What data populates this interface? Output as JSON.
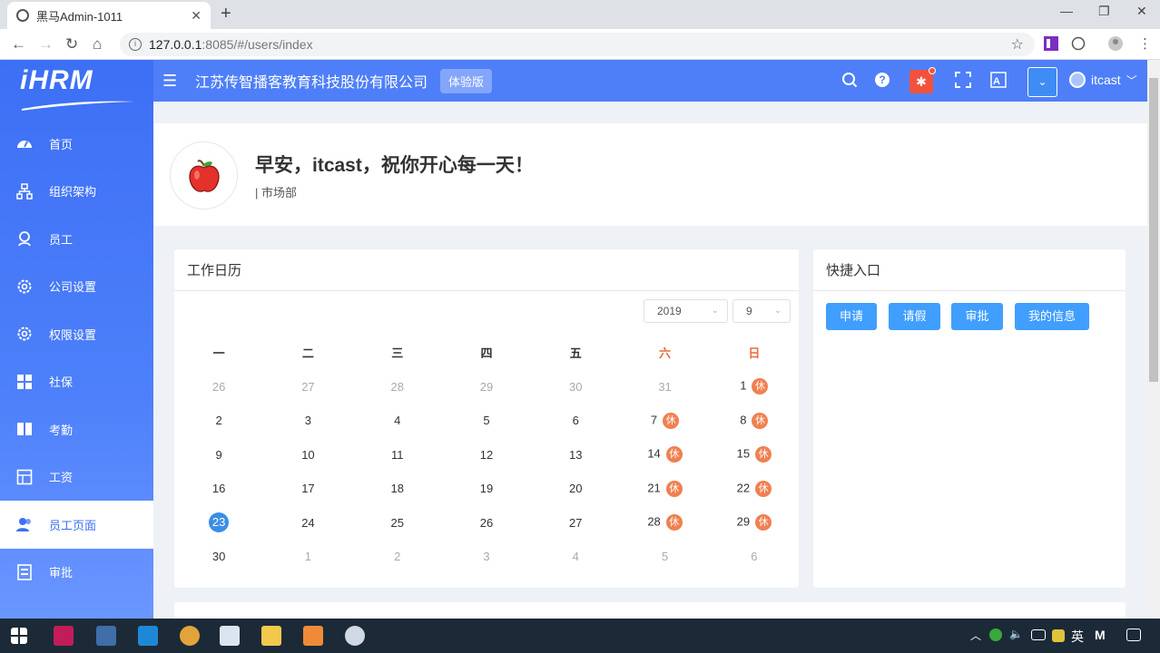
{
  "browser": {
    "tab_title": "黑马Admin-1011",
    "url_host": "127.0.0.1",
    "url_rest": ":8085/#/users/index"
  },
  "sidebar": {
    "logo": "iHRM",
    "items": [
      {
        "label": "首页",
        "icon": "dashboard-icon"
      },
      {
        "label": "组织架构",
        "icon": "org-tree-icon"
      },
      {
        "label": "员工",
        "icon": "people-icon"
      },
      {
        "label": "公司设置",
        "icon": "gear-icon"
      },
      {
        "label": "权限设置",
        "icon": "gear-icon"
      },
      {
        "label": "社保",
        "icon": "grid-icon"
      },
      {
        "label": "考勤",
        "icon": "book-icon"
      },
      {
        "label": "工资",
        "icon": "table-icon"
      },
      {
        "label": "员工页面",
        "icon": "user-icon"
      },
      {
        "label": "审批",
        "icon": "approval-icon"
      }
    ],
    "active_index": 8
  },
  "header": {
    "company": "江苏传智播客教育科技股份有限公司",
    "badge": "体验版",
    "username": "itcast"
  },
  "welcome": {
    "greeting": "早安，itcast，祝你开心每一天！",
    "department": "| 市场部"
  },
  "calendar": {
    "title": "工作日历",
    "year": "2019",
    "month": "9",
    "weekdays": [
      "一",
      "二",
      "三",
      "四",
      "五",
      "六",
      "日"
    ],
    "rest_label": "休",
    "weeks": [
      [
        {
          "d": "26",
          "dim": true
        },
        {
          "d": "27",
          "dim": true
        },
        {
          "d": "28",
          "dim": true
        },
        {
          "d": "29",
          "dim": true
        },
        {
          "d": "30",
          "dim": true
        },
        {
          "d": "31",
          "dim": true
        },
        {
          "d": "1",
          "rest": true
        }
      ],
      [
        {
          "d": "2"
        },
        {
          "d": "3"
        },
        {
          "d": "4"
        },
        {
          "d": "5"
        },
        {
          "d": "6"
        },
        {
          "d": "7",
          "rest": true
        },
        {
          "d": "8",
          "rest": true
        }
      ],
      [
        {
          "d": "9"
        },
        {
          "d": "10"
        },
        {
          "d": "11"
        },
        {
          "d": "12"
        },
        {
          "d": "13"
        },
        {
          "d": "14",
          "rest": true
        },
        {
          "d": "15",
          "rest": true
        }
      ],
      [
        {
          "d": "16"
        },
        {
          "d": "17"
        },
        {
          "d": "18"
        },
        {
          "d": "19"
        },
        {
          "d": "20"
        },
        {
          "d": "21",
          "rest": true
        },
        {
          "d": "22",
          "rest": true
        }
      ],
      [
        {
          "d": "23",
          "today": true
        },
        {
          "d": "24"
        },
        {
          "d": "25"
        },
        {
          "d": "26"
        },
        {
          "d": "27"
        },
        {
          "d": "28",
          "rest": true
        },
        {
          "d": "29",
          "rest": true
        }
      ],
      [
        {
          "d": "30"
        },
        {
          "d": "1",
          "dim": true
        },
        {
          "d": "2",
          "dim": true
        },
        {
          "d": "3",
          "dim": true
        },
        {
          "d": "4",
          "dim": true
        },
        {
          "d": "5",
          "dim": true
        },
        {
          "d": "6",
          "dim": true
        }
      ]
    ]
  },
  "quick": {
    "title": "快捷入口",
    "buttons": [
      "申请",
      "请假",
      "审批",
      "我的信息"
    ]
  },
  "taskbar": {
    "ime": "英",
    "ime2": "M"
  },
  "colors": {
    "primary": "#4e7ff8",
    "accent": "#409eff",
    "rest": "#f08050",
    "weekend": "#ec6a3e"
  }
}
